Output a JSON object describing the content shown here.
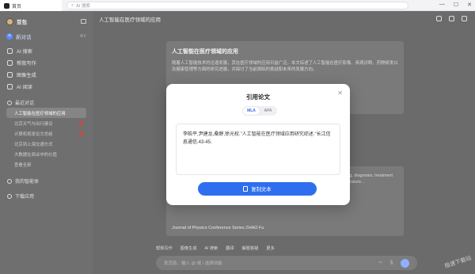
{
  "browser": {
    "tab_title": "首页",
    "address_placeholder": "AI 搜索"
  },
  "sidebar": {
    "app_name": "豆包",
    "new_chat_label": "新对话",
    "new_chat_shortcut": "⌘K",
    "nav": [
      {
        "label": "AI 搜索"
      },
      {
        "label": "帮我写作"
      },
      {
        "label": "图像生成"
      },
      {
        "label": "AI 阅读"
      }
    ],
    "recent_title": "最近对话",
    "history": [
      {
        "label": "人工智能在医疗领域的应用",
        "active": true,
        "badge": false
      },
      {
        "label": "北京天气与出行建议",
        "active": false,
        "badge": true
      },
      {
        "label": "计算机视觉论文总结",
        "active": false,
        "badge": true
      },
      {
        "label": "北京到上海交通方式",
        "active": false,
        "badge": false
      },
      {
        "label": "大数据在商业中的价值",
        "active": false,
        "badge": false
      },
      {
        "label": "查看全部",
        "active": false,
        "badge": false
      }
    ],
    "my_agents": "我的智能体",
    "download": "下载应用"
  },
  "main": {
    "conversation_title": "人工智能在医疗领域的应用",
    "card1_title": "人工智能在医疗领域的应用",
    "card1_body": "随着人工智能技术的迅速发展，其在医疗领域的应用日益广泛。本文综述了人工智能在医疗影像、疾病诊断、药物研发以及健康管理等方面的研究进展，并探讨了当前面临的挑战和未来的发展方向。",
    "card2_body": "Artificial intelligence has been widely applied in healthcare, with applications in medical imaging, diagnosis, treatment and health management. Through in-depth analysis of the various applications found in the literature...",
    "card2_source": "Journal of Physics Conference Series   ZHAO Fu",
    "tools": [
      "帮我写作",
      "图像生成",
      "AI 搜索",
      "翻译",
      "解题答疑",
      "更多"
    ],
    "input_placeholder": "发消息，输入 @ 或 / 选择技能"
  },
  "modal": {
    "title": "引用论文",
    "tabs": [
      {
        "label": "MLA",
        "active": true
      },
      {
        "label": "APA",
        "active": false
      }
    ],
    "citation": "李皓平,尹建龙,桑野,徐光权.\"人工智能在医疗领域应用研究综述.\"长江信息通信.43-45.",
    "copy_button": "复制文本",
    "close_icon": "close-icon"
  },
  "watermark": "极速下载站"
}
